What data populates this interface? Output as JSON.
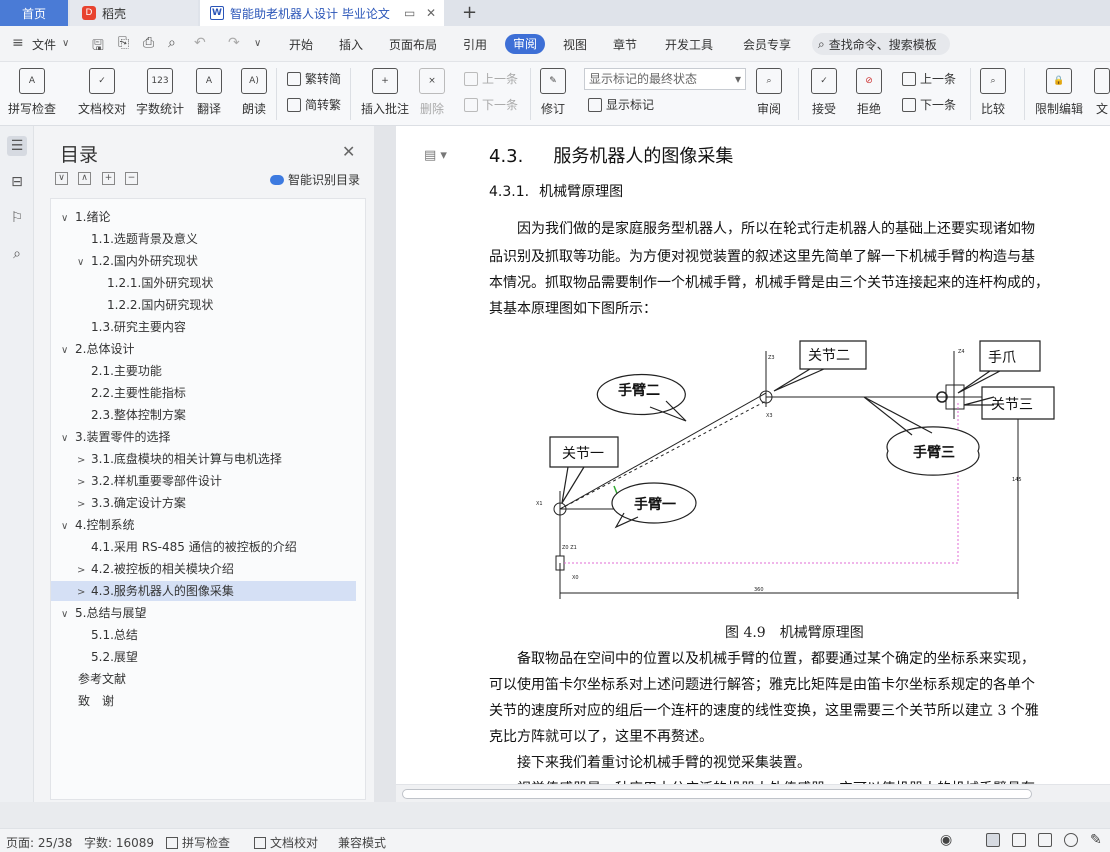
{
  "tabs": {
    "home": "首页",
    "daoke": "稻壳",
    "doc": "智能助老机器人设计 毕业论文",
    "new_tab": "+"
  },
  "menubar": {
    "file": "文件",
    "items": [
      "开始",
      "插入",
      "页面布局",
      "引用",
      "审阅",
      "视图",
      "章节",
      "开发工具",
      "会员专享"
    ],
    "active": "审阅",
    "search": "查找命令、搜索模板"
  },
  "ribbon": {
    "spell_check": "拼写检查",
    "doc_proof": "文档校对",
    "word_count": "字数统计",
    "translate": "翻译",
    "read_aloud": "朗读",
    "trad_to_simp": "繁转简",
    "simp_to_trad": "简转繁",
    "insert_comment": "插入批注",
    "delete": "删除",
    "prev_comment": "上一条",
    "next_comment": "下一条",
    "markup_state": "显示标记的最终状态",
    "revise": "修订",
    "show_markup": "显示标记",
    "review": "审阅",
    "accept": "接受",
    "reject": "拒绝",
    "prev_change": "上一条",
    "next_change": "下一条",
    "compare": "比较",
    "restrict_edit": "限制编辑",
    "doc_cut": "文"
  },
  "toc": {
    "title": "目录",
    "smart_toc": "智能识别目录",
    "items": [
      {
        "label": "1.绪论",
        "level": 1,
        "chev": "∨"
      },
      {
        "label": "1.1.选题背景及意义",
        "level": 2,
        "chev": ""
      },
      {
        "label": "1.2.国内外研究现状",
        "level": 2,
        "chev": "∨"
      },
      {
        "label": "1.2.1.国外研究现状",
        "level": 3,
        "chev": ""
      },
      {
        "label": "1.2.2.国内研究现状",
        "level": 3,
        "chev": ""
      },
      {
        "label": "1.3.研究主要内容",
        "level": 2,
        "chev": ""
      },
      {
        "label": "2.总体设计",
        "level": 1,
        "chev": "∨"
      },
      {
        "label": "2.1.主要功能",
        "level": 2,
        "chev": ""
      },
      {
        "label": "2.2.主要性能指标",
        "level": 2,
        "chev": ""
      },
      {
        "label": "2.3.整体控制方案",
        "level": 2,
        "chev": ""
      },
      {
        "label": "3.装置零件的选择",
        "level": 1,
        "chev": "∨"
      },
      {
        "label": "3.1.底盘模块的相关计算与电机选择",
        "level": 2,
        "chev": ">"
      },
      {
        "label": "3.2.样机重要零部件设计",
        "level": 2,
        "chev": ">"
      },
      {
        "label": "3.3.确定设计方案",
        "level": 2,
        "chev": ">"
      },
      {
        "label": "4.控制系统",
        "level": 1,
        "chev": "∨"
      },
      {
        "label": "4.1.采用 RS-485 通信的被控板的介绍",
        "level": 2,
        "chev": ""
      },
      {
        "label": "4.2.被控板的相关模块介绍",
        "level": 2,
        "chev": ">"
      },
      {
        "label": "4.3.服务机器人的图像采集",
        "level": 2,
        "chev": ">",
        "selected": true
      },
      {
        "label": "5.总结与展望",
        "level": 1,
        "chev": "∨"
      },
      {
        "label": "5.1.总结",
        "level": 2,
        "chev": ""
      },
      {
        "label": "5.2.展望",
        "level": 2,
        "chev": ""
      },
      {
        "label": "参考文献",
        "level": 0,
        "chev": ""
      },
      {
        "label": "致　谢",
        "level": 0,
        "chev": ""
      }
    ]
  },
  "document": {
    "h3_num": "4.3.",
    "h3_text": "服务机器人的图像采集",
    "h4_num": "4.3.1.",
    "h4_text": "机械臂原理图",
    "p1": [
      "　　因为我们做的是家庭服务型机器人，所以在轮式行走机器人的基础上还要实现诸如物",
      "品识别及抓取等功能。为方便对视觉装置的叙述这里先简单了解一下机械手臂的构造与基",
      "本情况。抓取物品需要制作一个机械手臂，机械手臂是由三个关节连接起来的连杆构成的，",
      "其基本原理图如下图所示："
    ],
    "figure_labels": {
      "arm2": "手臂二",
      "joint2": "关节二",
      "gripper": "手爪",
      "joint3": "关节三",
      "arm3": "手臂三",
      "joint1": "关节一",
      "arm1": "手臂一"
    },
    "caption": "图 4.9　机械臂原理图",
    "p2": [
      "　　备取物品在空间中的位置以及机械手臂的位置，都要通过某个确定的坐标系来实现，",
      "可以使用笛卡尔坐标系对上述问题进行解答；雅克比矩阵是由笛卡尔坐标系规定的各单个",
      "关节的速度所对应的组后一个连杆的速度的线性变换，这里需要三个关节所以建立 3 个雅",
      "克比方阵就可以了，这里不再赘述。",
      "　　接下来我们着重讨论机械手臂的视觉采集装置。",
      "　　视觉传感器是一种应用十分广泛的机器人外传感器，它可以使机器人的机械手臂具有"
    ]
  },
  "status": {
    "page": "页面: 25/38",
    "words": "字数: 16089",
    "spell": "拼写检查",
    "proof": "文档校对",
    "compat": "兼容模式"
  }
}
